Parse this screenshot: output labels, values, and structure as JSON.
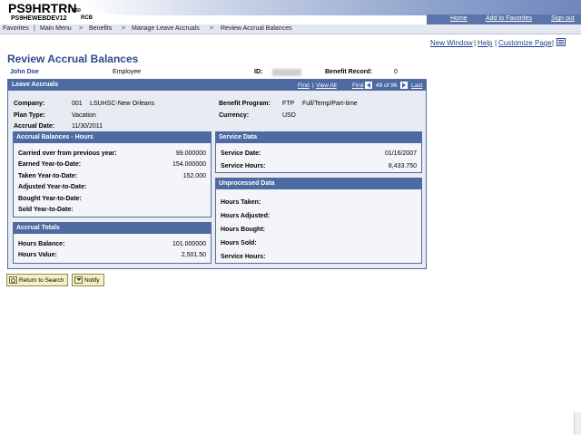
{
  "header": {
    "app_title": "PS9HRTRN",
    "app_version": "8.50",
    "server": "PS9HEWEBDEV12",
    "server_suffix": "RCB",
    "links": [
      "Home",
      "Add to Favorites",
      "Sign out"
    ]
  },
  "breadcrumb": {
    "items": [
      "Favorites",
      "Main Menu",
      "Benefits",
      "Manage Leave Accruals",
      "Review Accrual Balances"
    ],
    "separator": ">"
  },
  "utility_links": [
    "New Window",
    "Help",
    "Customize Page"
  ],
  "page_title": "Review Accrual Balances",
  "employee": {
    "name": "John Doe",
    "role": "Employee",
    "id_label": "ID:",
    "benefit_record_label": "Benefit Record:",
    "benefit_record": "0"
  },
  "leave_accruals": {
    "title": "Leave Accruals",
    "nav": {
      "find": "Find",
      "view_all": "View All",
      "first": "First",
      "position": "49 of 96",
      "last": "Last"
    },
    "company_label": "Company:",
    "company_code": "001",
    "company_name": "LSUHSC-New Orleans",
    "plan_type_label": "Plan Type:",
    "plan_type": "Vacation",
    "accrual_date_label": "Accrual Date:",
    "accrual_date": "11/30/2011",
    "benefit_program_label": "Benefit Program:",
    "benefit_program_code": "FTP",
    "benefit_program_name": "Full/Temp/Part-time",
    "currency_label": "Currency:",
    "currency": "USD"
  },
  "accrual_balances": {
    "title": "Accrual Balances - Hours",
    "rows": [
      {
        "label": "Carried over from previous year:",
        "value": "99.000000"
      },
      {
        "label": "Earned Year-to-Date:",
        "value": "154.000000"
      },
      {
        "label": "Taken Year-to-Date:",
        "value": "152.000"
      },
      {
        "label": "Adjusted Year-to-Date:",
        "value": ""
      },
      {
        "label": "Bought Year-to-Date:",
        "value": ""
      },
      {
        "label": "Sold Year-to-Date:",
        "value": ""
      }
    ]
  },
  "accrual_totals": {
    "title": "Accrual Totals",
    "rows": [
      {
        "label": "Hours Balance:",
        "value": "101.000000"
      },
      {
        "label": "Hours Value:",
        "value": "2,501.50"
      }
    ]
  },
  "service_data": {
    "title": "Service Data",
    "rows": [
      {
        "label": "Service Date:",
        "value": "01/16/2007"
      },
      {
        "label": "Service Hours:",
        "value": "8,433.750"
      }
    ]
  },
  "unprocessed_data": {
    "title": "Unprocessed Data",
    "rows": [
      {
        "label": "Hours Taken:"
      },
      {
        "label": "Hours Adjusted:"
      },
      {
        "label": "Hours Bought:"
      },
      {
        "label": "Hours Sold:"
      },
      {
        "label": "Service Hours:"
      }
    ]
  },
  "buttons": {
    "return_to_search": "Return to Search",
    "notify": "Notify"
  }
}
